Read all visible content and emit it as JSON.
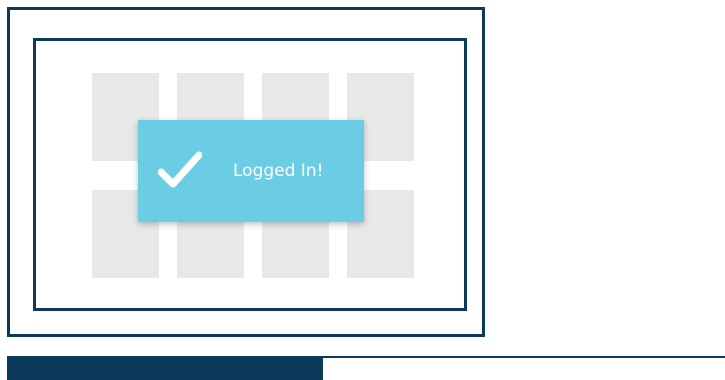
{
  "colors": {
    "frame": "#0c3a5a",
    "tile": "#e8e8e8",
    "toast_bg": "#6bcde3",
    "toast_text": "#ffffff",
    "progress_fill": "#0c3a5a"
  },
  "toast": {
    "icon": "checkmark-icon",
    "message": "Logged In!"
  },
  "grid": {
    "rows": 2,
    "columns": 4
  },
  "progress": {
    "value": 0.44
  }
}
